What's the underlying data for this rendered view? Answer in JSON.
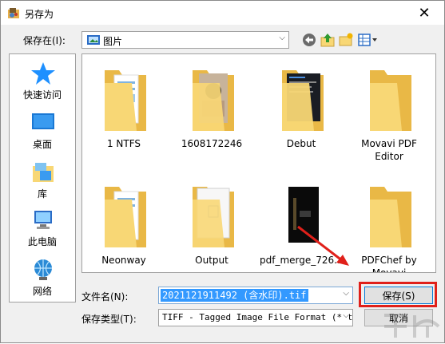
{
  "window": {
    "title": "另存为",
    "close_glyph": "✕"
  },
  "lookin": {
    "label": "保存在(I):",
    "value": "图片",
    "icon": "pictures-folder-icon"
  },
  "toolbar": [
    {
      "name": "back-button",
      "icon": "back-arrow-icon"
    },
    {
      "name": "up-folder-button",
      "icon": "up-folder-icon"
    },
    {
      "name": "new-folder-button",
      "icon": "new-folder-icon"
    },
    {
      "name": "view-menu-button",
      "icon": "view-menu-icon"
    }
  ],
  "places": [
    {
      "key": "quick-access",
      "label": "快速访问",
      "icon": "star-icon"
    },
    {
      "key": "desktop",
      "label": "桌面",
      "icon": "desktop-icon"
    },
    {
      "key": "library",
      "label": "库",
      "icon": "library-icon"
    },
    {
      "key": "this-pc",
      "label": "此电脑",
      "icon": "computer-icon"
    },
    {
      "key": "network",
      "label": "网络",
      "icon": "network-icon"
    }
  ],
  "files": [
    {
      "name": "1 NTFS",
      "thumb": "folder-with-docs"
    },
    {
      "name": "1608172246",
      "thumb": "folder-with-photo"
    },
    {
      "name": "Debut",
      "thumb": "folder-with-screen"
    },
    {
      "name": "Movavi PDF Editor",
      "thumb": "folder-plain"
    },
    {
      "name": "Neonway",
      "thumb": "folder-with-docs"
    },
    {
      "name": "Output",
      "thumb": "file-image"
    },
    {
      "name": "pdf_merge_726...",
      "thumb": "file-dark"
    },
    {
      "name": "PDFChef by Movavi",
      "thumb": "folder-plain"
    }
  ],
  "filename": {
    "label": "文件名(N):",
    "value": "2021121911492 (含水印).tif"
  },
  "filetype": {
    "label": "保存类型(T):",
    "value": "TIFF - Tagged Image File Format (*.ti"
  },
  "buttons": {
    "save": "保存(S)",
    "cancel": "取消"
  },
  "colors": {
    "highlight": "#e0201a",
    "folder": "#f8d775",
    "selection": "#3399ff"
  }
}
